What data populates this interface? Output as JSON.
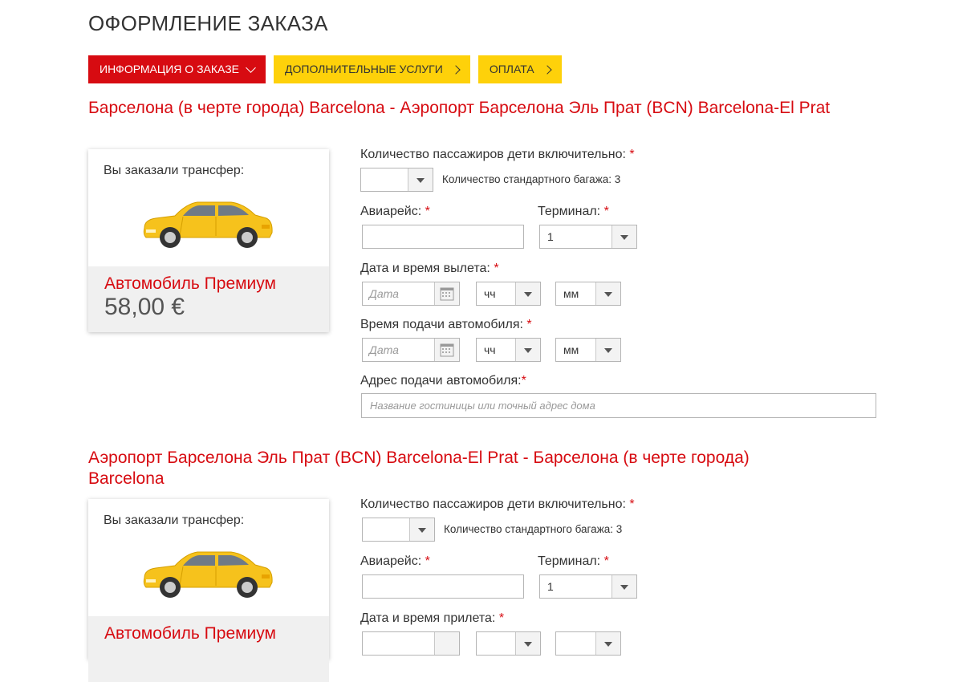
{
  "page": {
    "title": "ОФОРМЛЕНИЕ ЗАКАЗА"
  },
  "steps": [
    {
      "label": "ИНФОРМАЦИЯ О ЗАКАЗЕ"
    },
    {
      "label": "ДОПОЛНИТЕЛЬНЫЕ УСЛУГИ"
    },
    {
      "label": "ОПЛАТА"
    }
  ],
  "colors": {
    "accent_red": "#d70b11",
    "accent_yellow": "#fed10a"
  },
  "transfers": [
    {
      "route": "Барселона (в черте города) Barcelona - Аэропорт Барселона Эль Прат (BCN) Barcelona-El Prat",
      "card": {
        "label": "Вы заказали трансфер:",
        "car_name": "Автомобиль Премиум",
        "price": "58,00 €"
      },
      "passengers_label": "Количество пассажиров дети включительно:",
      "passengers_value": "",
      "luggage_note": "Количество стандартного багажа: 3",
      "flight_label": "Авиарейс:",
      "terminal_label": "Терминал:",
      "terminal_value": "1",
      "datetime_label": "Дата и время вылета:",
      "date_placeholder": "Дата",
      "hour_value": "чч",
      "minute_value": "мм",
      "pickup_time_label": "Время подачи автомобиля:",
      "pickup_date_placeholder": "Дата",
      "pickup_hour_value": "чч",
      "pickup_minute_value": "мм",
      "address_label": "Адрес подачи автомобиля:",
      "address_placeholder": "Название гостиницы или точный адрес дома"
    },
    {
      "route": "Аэропорт Барселона Эль Прат (BCN) Barcelona-El Prat - Барселона (в черте города) Barcelona",
      "card": {
        "label": "Вы заказали трансфер:",
        "car_name": "Автомобиль Премиум"
      },
      "passengers_label": "Количество пассажиров дети включительно:",
      "passengers_value": "",
      "luggage_note": "Количество стандартного багажа: 3",
      "flight_label": "Авиарейс:",
      "terminal_label": "Терминал:",
      "terminal_value": "1",
      "datetime_label": "Дата и время прилета:"
    }
  ],
  "required_mark": "*"
}
